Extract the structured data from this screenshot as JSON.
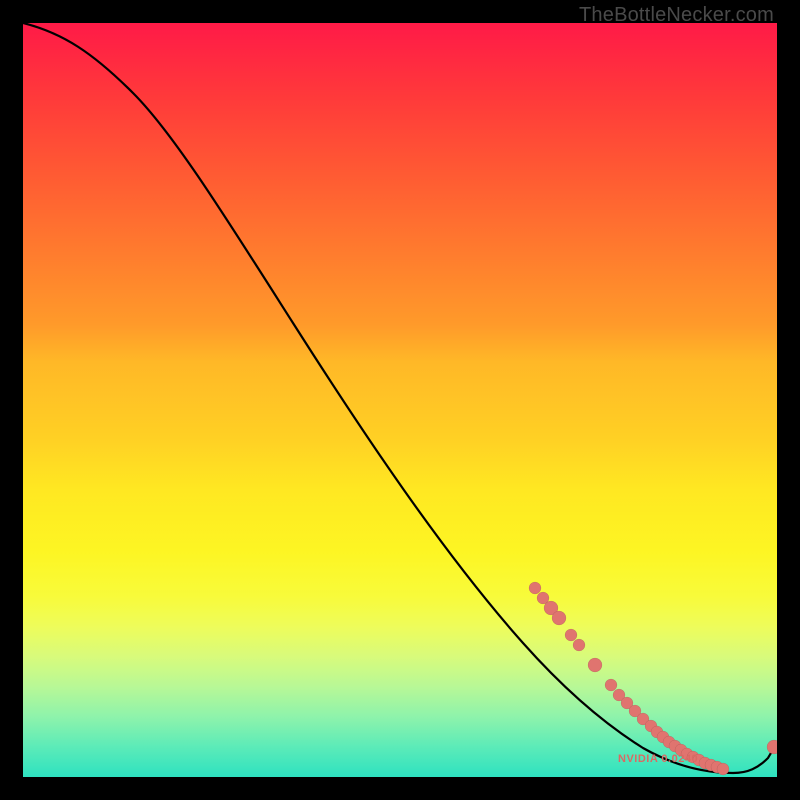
{
  "watermark": "TheBottleNecker.com",
  "chart_data": {
    "type": "line",
    "title": "",
    "xlabel": "",
    "ylabel": "",
    "xlim": [
      0,
      100
    ],
    "ylim": [
      0,
      100
    ],
    "series": [
      {
        "name": "bottleneck-curve",
        "x": [
          0,
          5,
          10,
          15,
          20,
          25,
          30,
          35,
          40,
          45,
          50,
          55,
          60,
          65,
          70,
          73,
          76,
          78,
          80,
          82,
          84,
          86,
          88,
          90,
          92,
          94,
          96,
          98,
          100
        ],
        "y": [
          100,
          99,
          97,
          93.5,
          89,
          84,
          78,
          72,
          65,
          58,
          51,
          44,
          37,
          30,
          23,
          18,
          14,
          11.5,
          9,
          7,
          5.2,
          3.8,
          2.6,
          1.7,
          1.0,
          0.6,
          0.6,
          1.6,
          4
        ]
      }
    ],
    "cluster_points": {
      "name": "highlighted-points",
      "x": [
        68,
        69,
        70,
        71,
        73,
        74,
        76,
        78,
        79,
        80,
        81,
        82,
        83,
        84,
        85,
        86,
        87,
        88,
        89,
        90,
        91,
        92,
        93,
        99.5
      ],
      "y": [
        25,
        24,
        22,
        20.5,
        17,
        16,
        13,
        10,
        9,
        8,
        7,
        6,
        5.3,
        4.7,
        4.1,
        3.6,
        3.1,
        2.6,
        2.2,
        1.8,
        1.5,
        1.2,
        1.0,
        3.5
      ]
    },
    "annotations": [
      {
        "text": "NVIDIA 0.0240",
        "x": 84,
        "y": 2
      }
    ],
    "background_gradient": {
      "top": "#ff1a47",
      "mid": "#ffe822",
      "bottom": "#2ee2c0"
    }
  }
}
